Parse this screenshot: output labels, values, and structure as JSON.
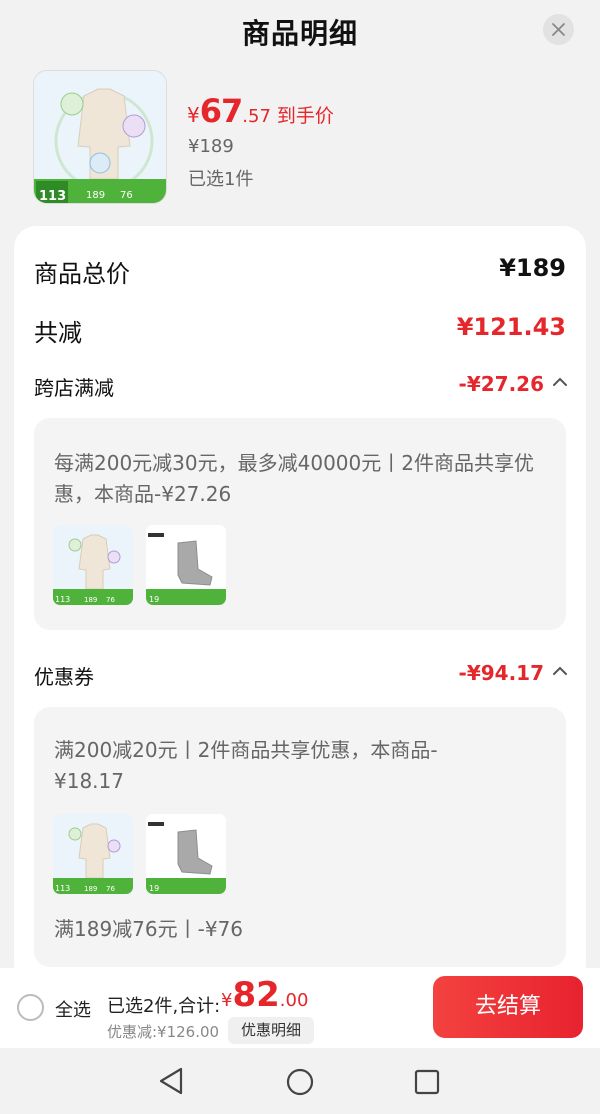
{
  "header": {
    "title": "商品明细"
  },
  "product": {
    "price_symbol": "¥",
    "price_int": "67",
    "price_dec": ".57",
    "price_label": "到手价",
    "original_price": "¥189",
    "selected": "已选1件"
  },
  "breakdown": {
    "total_label": "商品总价",
    "total_value": "¥189",
    "reduce_label": "共减",
    "reduce_value": "¥121.43",
    "cross_store": {
      "label": "跨店满减",
      "value": "-¥27.26",
      "detail": "每满200元减30元，最多减40000元丨2件商品共享优惠，本商品-¥27.26"
    },
    "coupon": {
      "label": "优惠券",
      "value": "-¥94.17",
      "detail": "满200减20元丨2件商品共享优惠，本商品-¥18.17",
      "extra": "满189减76元丨-¥76"
    }
  },
  "bottom_bar": {
    "select_all": "全选",
    "summary": "已选2件,合计:",
    "sum_symbol": "¥",
    "sum_int": "82",
    "sum_dec": ".00",
    "discount_note": "优惠减:¥126.00",
    "detail_chip": "优惠明细",
    "checkout": "去结算"
  },
  "colors": {
    "accent": "#e5262b",
    "checkout_start": "#f3423f",
    "checkout_end": "#e8222f"
  },
  "icons": [
    "close-icon",
    "chevron-up-icon",
    "nav-back-icon",
    "nav-home-icon",
    "nav-recents-icon"
  ]
}
